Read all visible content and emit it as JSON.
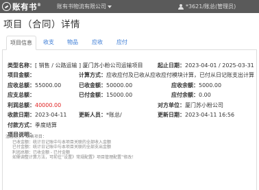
{
  "header": {
    "logo_text": "账有书",
    "logo_reg": "®",
    "company": "账有书物流有限公司",
    "user": "*3621/账总(管理员)"
  },
  "page_title": "项目（合同）详情",
  "tabs": [
    {
      "label": "项目信息"
    },
    {
      "label": "收支"
    },
    {
      "label": "物品"
    },
    {
      "label": "应收"
    },
    {
      "label": "应付"
    }
  ],
  "fields": {
    "type_label": "类型名称：",
    "type_value": "[ 销售 / 公路运输 ] 厦门苏小粉公司运输项目",
    "start_label": "起止日期：",
    "start_value": "2023-04-01 / 2025-03-31",
    "amount_label": "项目金额：",
    "amount_value": "",
    "calc_label": "计算方式：",
    "calc_value": "应收应付及已收从应收应付模块计算，已付从日记账支出计算",
    "receivable_label": "应收总额：",
    "receivable_value": "55000.00",
    "received_label": "已收金额：",
    "received_value": "50000.00",
    "receivable_balance_label": "应收余额：",
    "receivable_balance_value": "5000.00",
    "payable_label": "应支总额：",
    "payable_value": "",
    "paid_label": "已付金额：",
    "paid_value": "15000.00",
    "payable_balance_label": "应付余额：",
    "payable_balance_value": "0.00",
    "profit_label": "利润总额：",
    "profit_value": "40000.00",
    "counterparty_label": "对方单位：",
    "counterparty_value": "厦门苏小粉公司",
    "pay_date_label": "收款日期：",
    "pay_date_value": "2023-04-11",
    "updater_label": "更新人员：",
    "updater_value": "*账总/",
    "update_date_label": "更新日期：",
    "update_date_value": "2023-04-11 16:56",
    "pay_method_label": "付款方式：",
    "pay_method_value": "季度结算",
    "desc_label": "项目说明：",
    "desc_value": ""
  },
  "tips": {
    "title": "温馨提示，销售项目：",
    "lines": [
      "已收金额：统计日记账中与本项目关联的全部收入金额",
      "已付金额：统计日记账中与本项目关联的全部支出金额",
      "利润总额：已收金额 - 已付金额",
      "如需调整计算方法，可前往“设置》常规配置》项目管理配置”修改！"
    ]
  }
}
